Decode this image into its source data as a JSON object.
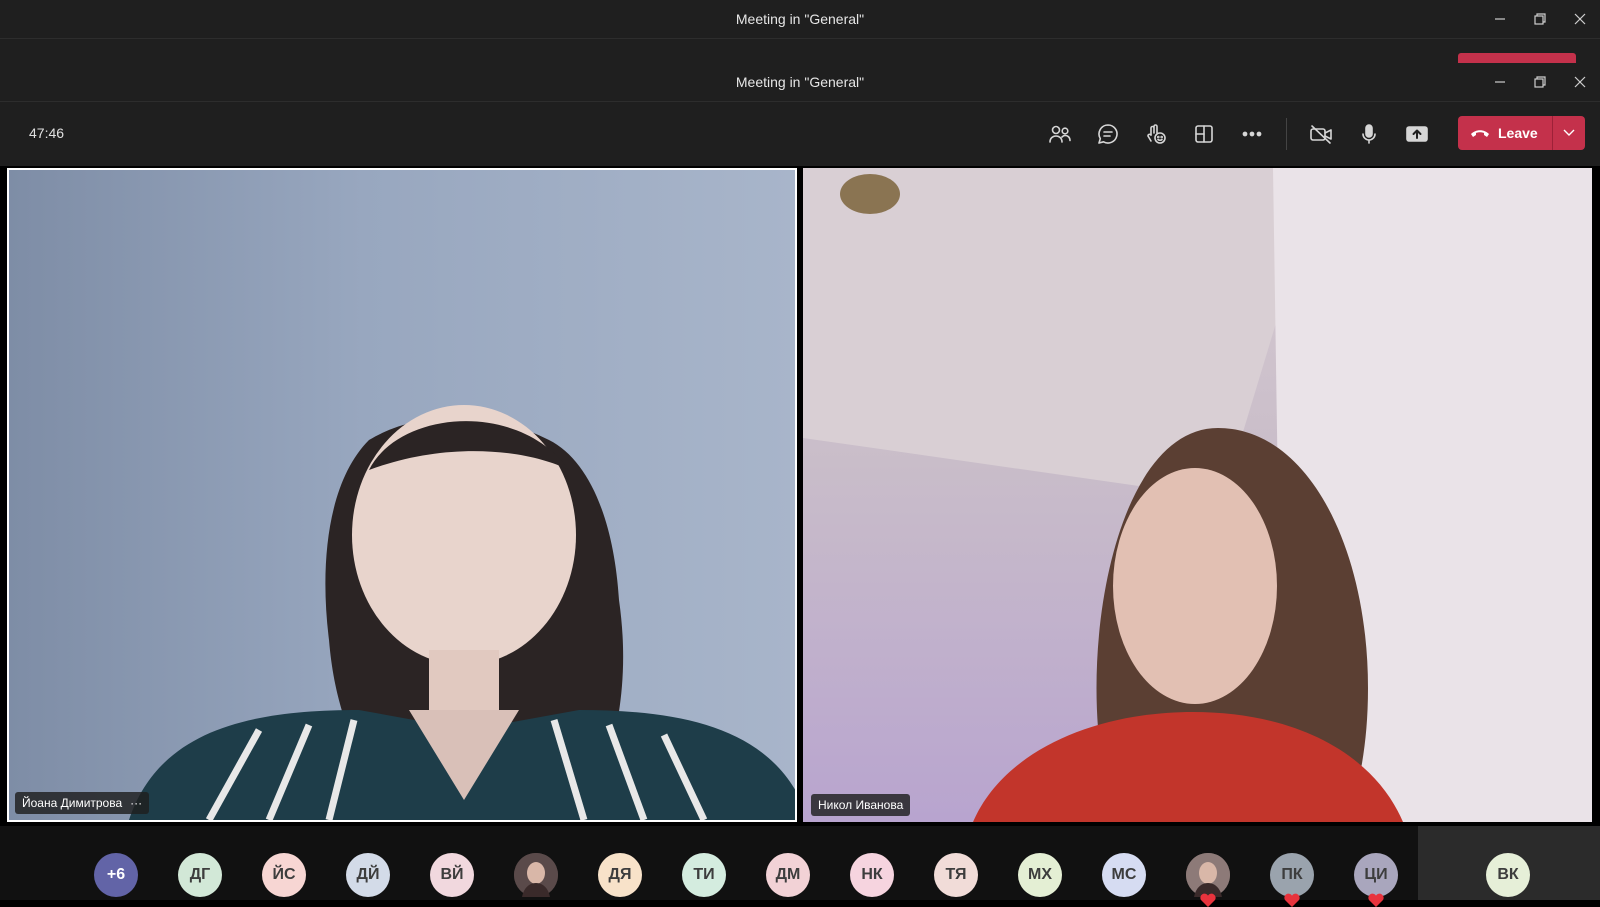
{
  "window_back": {
    "title": "Meeting in \"General\""
  },
  "window": {
    "title": "Meeting in \"General\""
  },
  "toolbar": {
    "timer": "47:46",
    "icons": [
      "people-icon",
      "chat-icon",
      "reactions-icon",
      "rooms-icon",
      "more-icon",
      "camera-off-icon",
      "mic-icon",
      "share-screen-icon"
    ],
    "leave_label": "Leave",
    "leave_color": "#c4314b"
  },
  "videos": {
    "left": {
      "name": "Йоана Димитрова",
      "more": "···"
    },
    "right": {
      "name": "Никол Иванова"
    }
  },
  "roster": {
    "overflow": "+6",
    "avatars": [
      {
        "initials": "ДГ",
        "color": "#d2e8d7"
      },
      {
        "initials": "ЙС",
        "color": "#f7d6d3"
      },
      {
        "initials": "ДЙ",
        "color": "#d3dbe8"
      },
      {
        "initials": "ВЙ",
        "color": "#f1d8de"
      },
      {
        "initials": "",
        "color": "#5a4a4a",
        "photo": true
      },
      {
        "initials": "ДЯ",
        "color": "#f8e2c9"
      },
      {
        "initials": "ТИ",
        "color": "#d4ecdf"
      },
      {
        "initials": "ДМ",
        "color": "#f2d2d6"
      },
      {
        "initials": "НК",
        "color": "#f6d4df"
      },
      {
        "initials": "ТЯ",
        "color": "#f1dcd8"
      },
      {
        "initials": "МХ",
        "color": "#e4efd4"
      },
      {
        "initials": "МС",
        "color": "#d6dcf2"
      },
      {
        "initials": "",
        "color": "#8d7a78",
        "photo": true,
        "heart": true
      },
      {
        "initials": "ПК",
        "color": "#9aa3ad",
        "heart": true
      },
      {
        "initials": "ЦИ",
        "color": "#a9a6bd",
        "heart": true
      }
    ],
    "last": {
      "initials": "ВК",
      "color": "#e6efd8"
    }
  }
}
